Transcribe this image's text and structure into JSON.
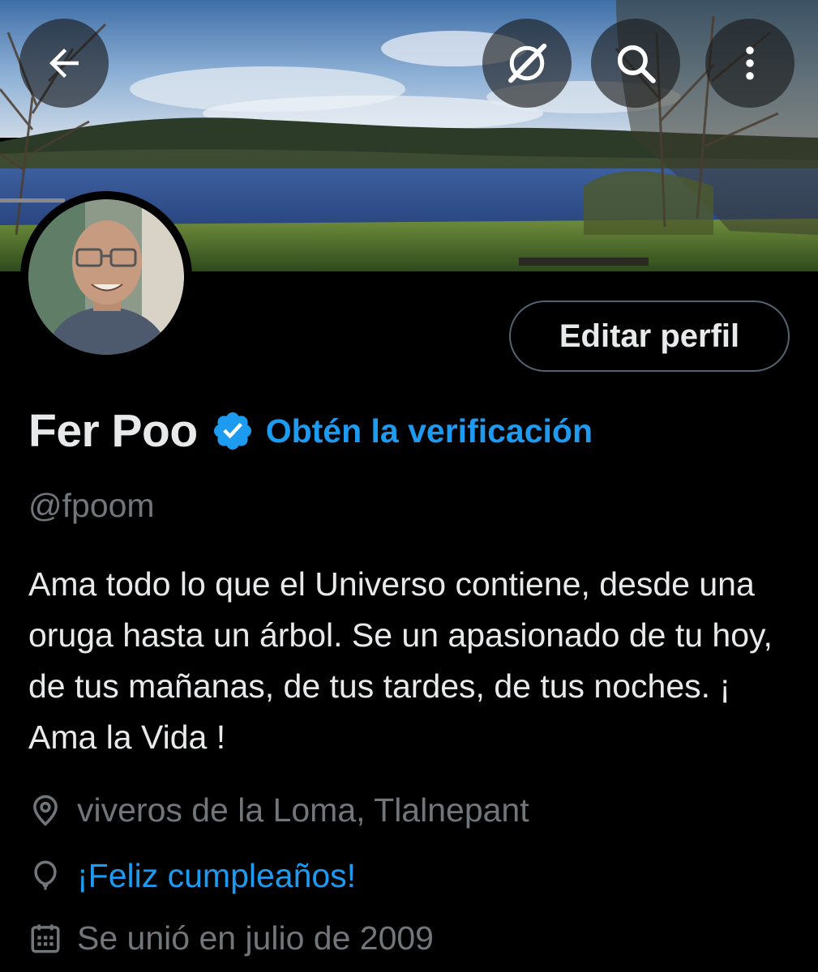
{
  "header": {
    "back_icon": "arrow-left-icon",
    "grok_icon": "grok-slash-icon",
    "search_icon": "search-icon",
    "more_icon": "more-vertical-icon"
  },
  "profile": {
    "display_name": "Fer Poo",
    "verified_icon": "verified-badge-icon",
    "get_verified_label": "Obtén la verificación",
    "handle": "@fpoom",
    "edit_profile_label": "Editar perfil",
    "bio": "Ama todo lo que el Universo contiene, desde una oruga hasta un árbol. Se un apasionado de tu hoy, de tus mañanas, de tus tardes, de tus noches. ¡ Ama la Vida !",
    "location": "viveros de la Loma, Tlalnepant",
    "location_icon": "location-pin-icon",
    "birthday": "¡Feliz cumpleaños!",
    "birthday_icon": "balloon-icon",
    "joined": "Se unió en julio de 2009",
    "joined_icon": "calendar-icon"
  },
  "colors": {
    "background": "#000000",
    "primary_text": "#e7e9ea",
    "secondary_text": "#71767b",
    "accent": "#1d9bf0",
    "button_border": "#536471"
  }
}
